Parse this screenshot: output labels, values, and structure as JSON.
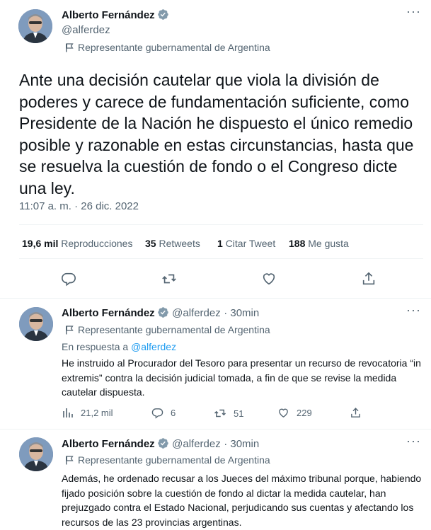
{
  "main_tweet": {
    "author_name": "Alberto Fernández",
    "author_handle": "@alferdez",
    "affiliation": "Representante gubernamental de Argentina",
    "text": "Ante una decisión cautelar que viola la división de poderes y carece de fundamentación suficiente, como Presidente de la Nación he dispuesto el único remedio posible y razonable en estas circunstancias, hasta que se resuelva la cuestión de fondo o el Congreso dicte una ley.",
    "timestamp": "11:07 a. m. · 26 dic. 2022",
    "stats": {
      "views_count": "19,6 mil",
      "views_label": "Reproducciones",
      "retweets_count": "35",
      "retweets_label": "Retweets",
      "quotes_count": "1",
      "quotes_label": "Citar Tweet",
      "likes_count": "188",
      "likes_label": "Me gusta"
    }
  },
  "replies": [
    {
      "author_name": "Alberto Fernández",
      "author_handle": "@alferdez",
      "time_ago": "· 30min",
      "affiliation": "Representante gubernamental de Argentina",
      "reply_to_prefix": "En respuesta a",
      "reply_to_handle": "@alferdez",
      "text": "He instruido al Procurador del Tesoro para presentar un recurso de revocatoria “in extremis” contra la decisión judicial tomada, a fin de que se revise la medida cautelar dispuesta.",
      "views": "21,2 mil",
      "replies": "6",
      "retweets": "51",
      "likes": "229"
    },
    {
      "author_name": "Alberto Fernández",
      "author_handle": "@alferdez",
      "time_ago": "· 30min",
      "affiliation": "Representante gubernamental de Argentina",
      "text": "Además, he ordenado recusar a los Jueces del máximo tribunal porque, habiendo fijado posición sobre la cuestión de fondo al dictar la medida cautelar, han prejuzgado contra el Estado Nacional, perjudicando sus cuentas y afectando los recursos de las 23 provincias argentinas."
    }
  ],
  "colors": {
    "accent": "#1d9bf0",
    "secondary_text": "#536471",
    "divider": "#eff3f4",
    "verified_badge": "#829aab"
  }
}
